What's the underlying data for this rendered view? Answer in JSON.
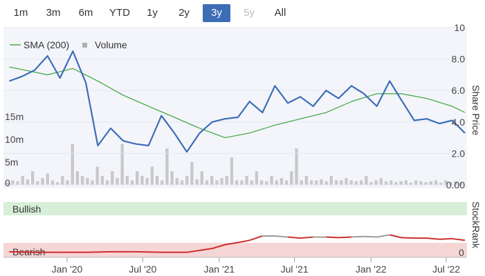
{
  "range_buttons": [
    {
      "label": "1m",
      "state": "normal"
    },
    {
      "label": "3m",
      "state": "normal"
    },
    {
      "label": "6m",
      "state": "normal"
    },
    {
      "label": "YTD",
      "state": "normal"
    },
    {
      "label": "1y",
      "state": "normal"
    },
    {
      "label": "2y",
      "state": "normal"
    },
    {
      "label": "3y",
      "state": "active"
    },
    {
      "label": "5y",
      "state": "disabled"
    },
    {
      "label": "All",
      "state": "normal"
    }
  ],
  "legend": {
    "sma": "SMA (200)",
    "volume": "Volume"
  },
  "colors": {
    "price": "#3d6db5",
    "sma": "#4aaa4a",
    "volume": "#c8c8c8",
    "plot_bg": "#f3f5fb",
    "bullish_bg": "#d7eed9",
    "bearish_bg": "#f6d5d5",
    "rank_bear": "#cc2c2c",
    "rank_neutral": "#9a9a9a",
    "active_button": "#3d6db5"
  },
  "chart_data": [
    {
      "type": "line",
      "y_axis_title": "Share Price",
      "y_ticks": [
        "10",
        "8.0",
        "6.0",
        "4.0",
        "2.0",
        "0.00"
      ],
      "ylim": [
        0,
        10
      ],
      "volume_ticks": [
        "15m",
        "10m",
        "5m",
        "0"
      ],
      "x_ticks": [
        "Jan '20",
        "Jul '20",
        "Jan '21",
        "Jul '21",
        "Jan '22",
        "Jul '22"
      ],
      "series": [
        {
          "name": "Share Price",
          "x": [
            "2019-08",
            "2019-09",
            "2019-10",
            "2019-11",
            "2019-12",
            "2020-01",
            "2020-02",
            "2020-03",
            "2020-04",
            "2020-05",
            "2020-06",
            "2020-07",
            "2020-08",
            "2020-09",
            "2020-10",
            "2020-11",
            "2020-12",
            "2021-01",
            "2021-02",
            "2021-03",
            "2021-04",
            "2021-05",
            "2021-06",
            "2021-07",
            "2021-08",
            "2021-09",
            "2021-10",
            "2021-11",
            "2021-12",
            "2022-01",
            "2022-02",
            "2022-03",
            "2022-04",
            "2022-05",
            "2022-06",
            "2022-07",
            "2022-08"
          ],
          "y": [
            6.6,
            6.9,
            7.3,
            8.2,
            6.8,
            8.5,
            6.5,
            2.5,
            3.6,
            2.8,
            2.6,
            2.5,
            4.4,
            3.3,
            2.1,
            3.3,
            4.0,
            4.2,
            4.3,
            5.3,
            4.6,
            6.3,
            5.2,
            5.6,
            5.0,
            6.0,
            5.5,
            6.3,
            5.8,
            5.0,
            6.6,
            5.4,
            4.1,
            4.2,
            3.9,
            4.1,
            3.3
          ]
        },
        {
          "name": "SMA (200)",
          "x": [
            "2019-08",
            "2019-11",
            "2020-01",
            "2020-03",
            "2020-05",
            "2020-07",
            "2020-09",
            "2020-11",
            "2021-01",
            "2021-03",
            "2021-05",
            "2021-07",
            "2021-09",
            "2021-11",
            "2022-01",
            "2022-03",
            "2022-05",
            "2022-07",
            "2022-08"
          ],
          "y": [
            7.5,
            7.0,
            7.4,
            6.6,
            5.7,
            5.0,
            4.3,
            3.6,
            3.0,
            3.3,
            3.8,
            4.2,
            4.6,
            5.3,
            5.8,
            5.8,
            5.5,
            5.0,
            4.6
          ]
        }
      ],
      "volume": {
        "unit": "m",
        "samples_m": [
          0.5,
          1,
          0.8,
          2,
          1.2,
          3,
          0.8,
          1.5,
          2.5,
          1,
          0.6,
          2,
          1,
          9,
          3,
          2,
          1.5,
          1,
          4,
          2,
          1,
          3,
          1.5,
          9,
          2,
          1,
          3,
          2,
          1.5,
          4,
          2,
          1,
          8,
          3,
          1.5,
          1,
          2,
          5,
          1.2,
          3,
          1,
          2,
          1,
          1.5,
          2,
          6,
          1,
          1,
          2,
          1,
          3,
          1,
          0.8,
          2,
          1,
          1.5,
          1,
          3,
          8,
          1,
          2,
          1,
          1,
          1.2,
          0.8,
          2,
          1,
          1,
          1.5,
          1,
          0.8,
          1,
          2,
          0.6,
          1,
          1.5,
          0.8,
          1,
          0.6,
          0.8,
          1,
          0.5,
          1,
          0.8,
          0.6,
          0.8,
          1,
          0.5,
          1,
          0.6,
          0.8,
          0.5
        ]
      }
    },
    {
      "type": "area",
      "y_axis_title": "StockRank",
      "band_labels": {
        "top": "Bullish",
        "bottom": "Bearish"
      },
      "y_ticks": [
        "0"
      ],
      "x": [
        "2019-08",
        "2019-10",
        "2019-12",
        "2020-02",
        "2020-04",
        "2020-06",
        "2020-08",
        "2020-10",
        "2020-12",
        "2021-01",
        "2021-02",
        "2021-03",
        "2021-04",
        "2021-05",
        "2021-06",
        "2021-07",
        "2021-08",
        "2021-09",
        "2021-10",
        "2021-11",
        "2021-12",
        "2022-01",
        "2022-02",
        "2022-03",
        "2022-04",
        "2022-05",
        "2022-06",
        "2022-07",
        "2022-08"
      ],
      "rank": [
        9,
        8,
        8,
        8,
        9,
        9,
        8,
        8,
        15,
        22,
        26,
        30,
        38,
        38,
        36,
        34,
        36,
        36,
        35,
        36,
        37,
        36,
        40,
        35,
        34,
        34,
        32,
        33,
        30
      ]
    }
  ]
}
